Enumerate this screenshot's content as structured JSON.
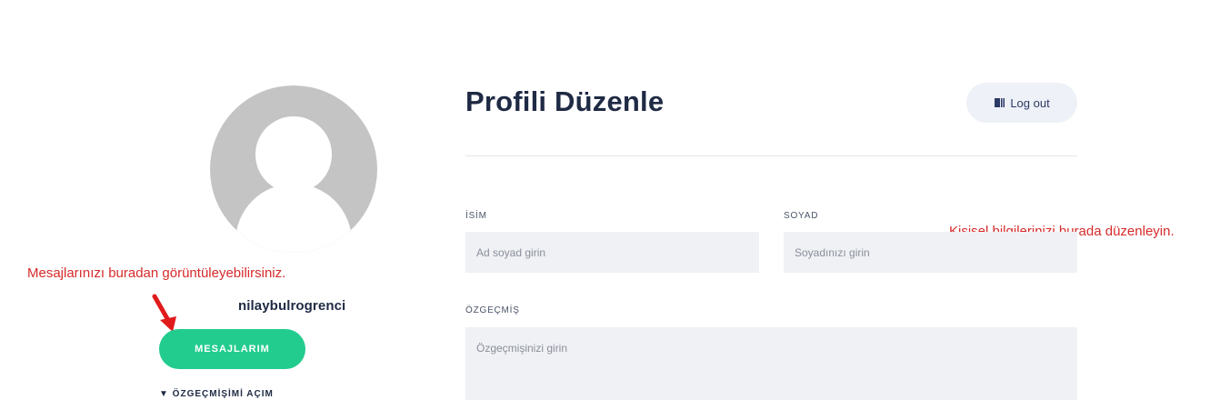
{
  "profile": {
    "username": "nilaybulrogrenci",
    "messages_button": "MESAJLARIM",
    "below_button_partial": "▼ ÖZGEÇMİŞİMİ AÇIM"
  },
  "annotations": {
    "left_hint": "Mesajlarınızı buradan görüntüleyebilirsiniz.",
    "right_hint": "Kişisel bilgilerinizi burada düzenleyin."
  },
  "header": {
    "title": "Profili Düzenle",
    "logout_label": "Log out"
  },
  "form": {
    "name_label": "İSİM",
    "name_placeholder": "Ad soyad girin",
    "surname_label": "SOYAD",
    "surname_placeholder": "Soyadınızı girin",
    "bio_label": "ÖZGEÇMİŞ",
    "bio_placeholder": "Özgeçmişinizi girin"
  },
  "colors": {
    "accent_green": "#22cc8e",
    "annotation_red": "#d62b2b",
    "title_navy": "#1f2a44"
  }
}
